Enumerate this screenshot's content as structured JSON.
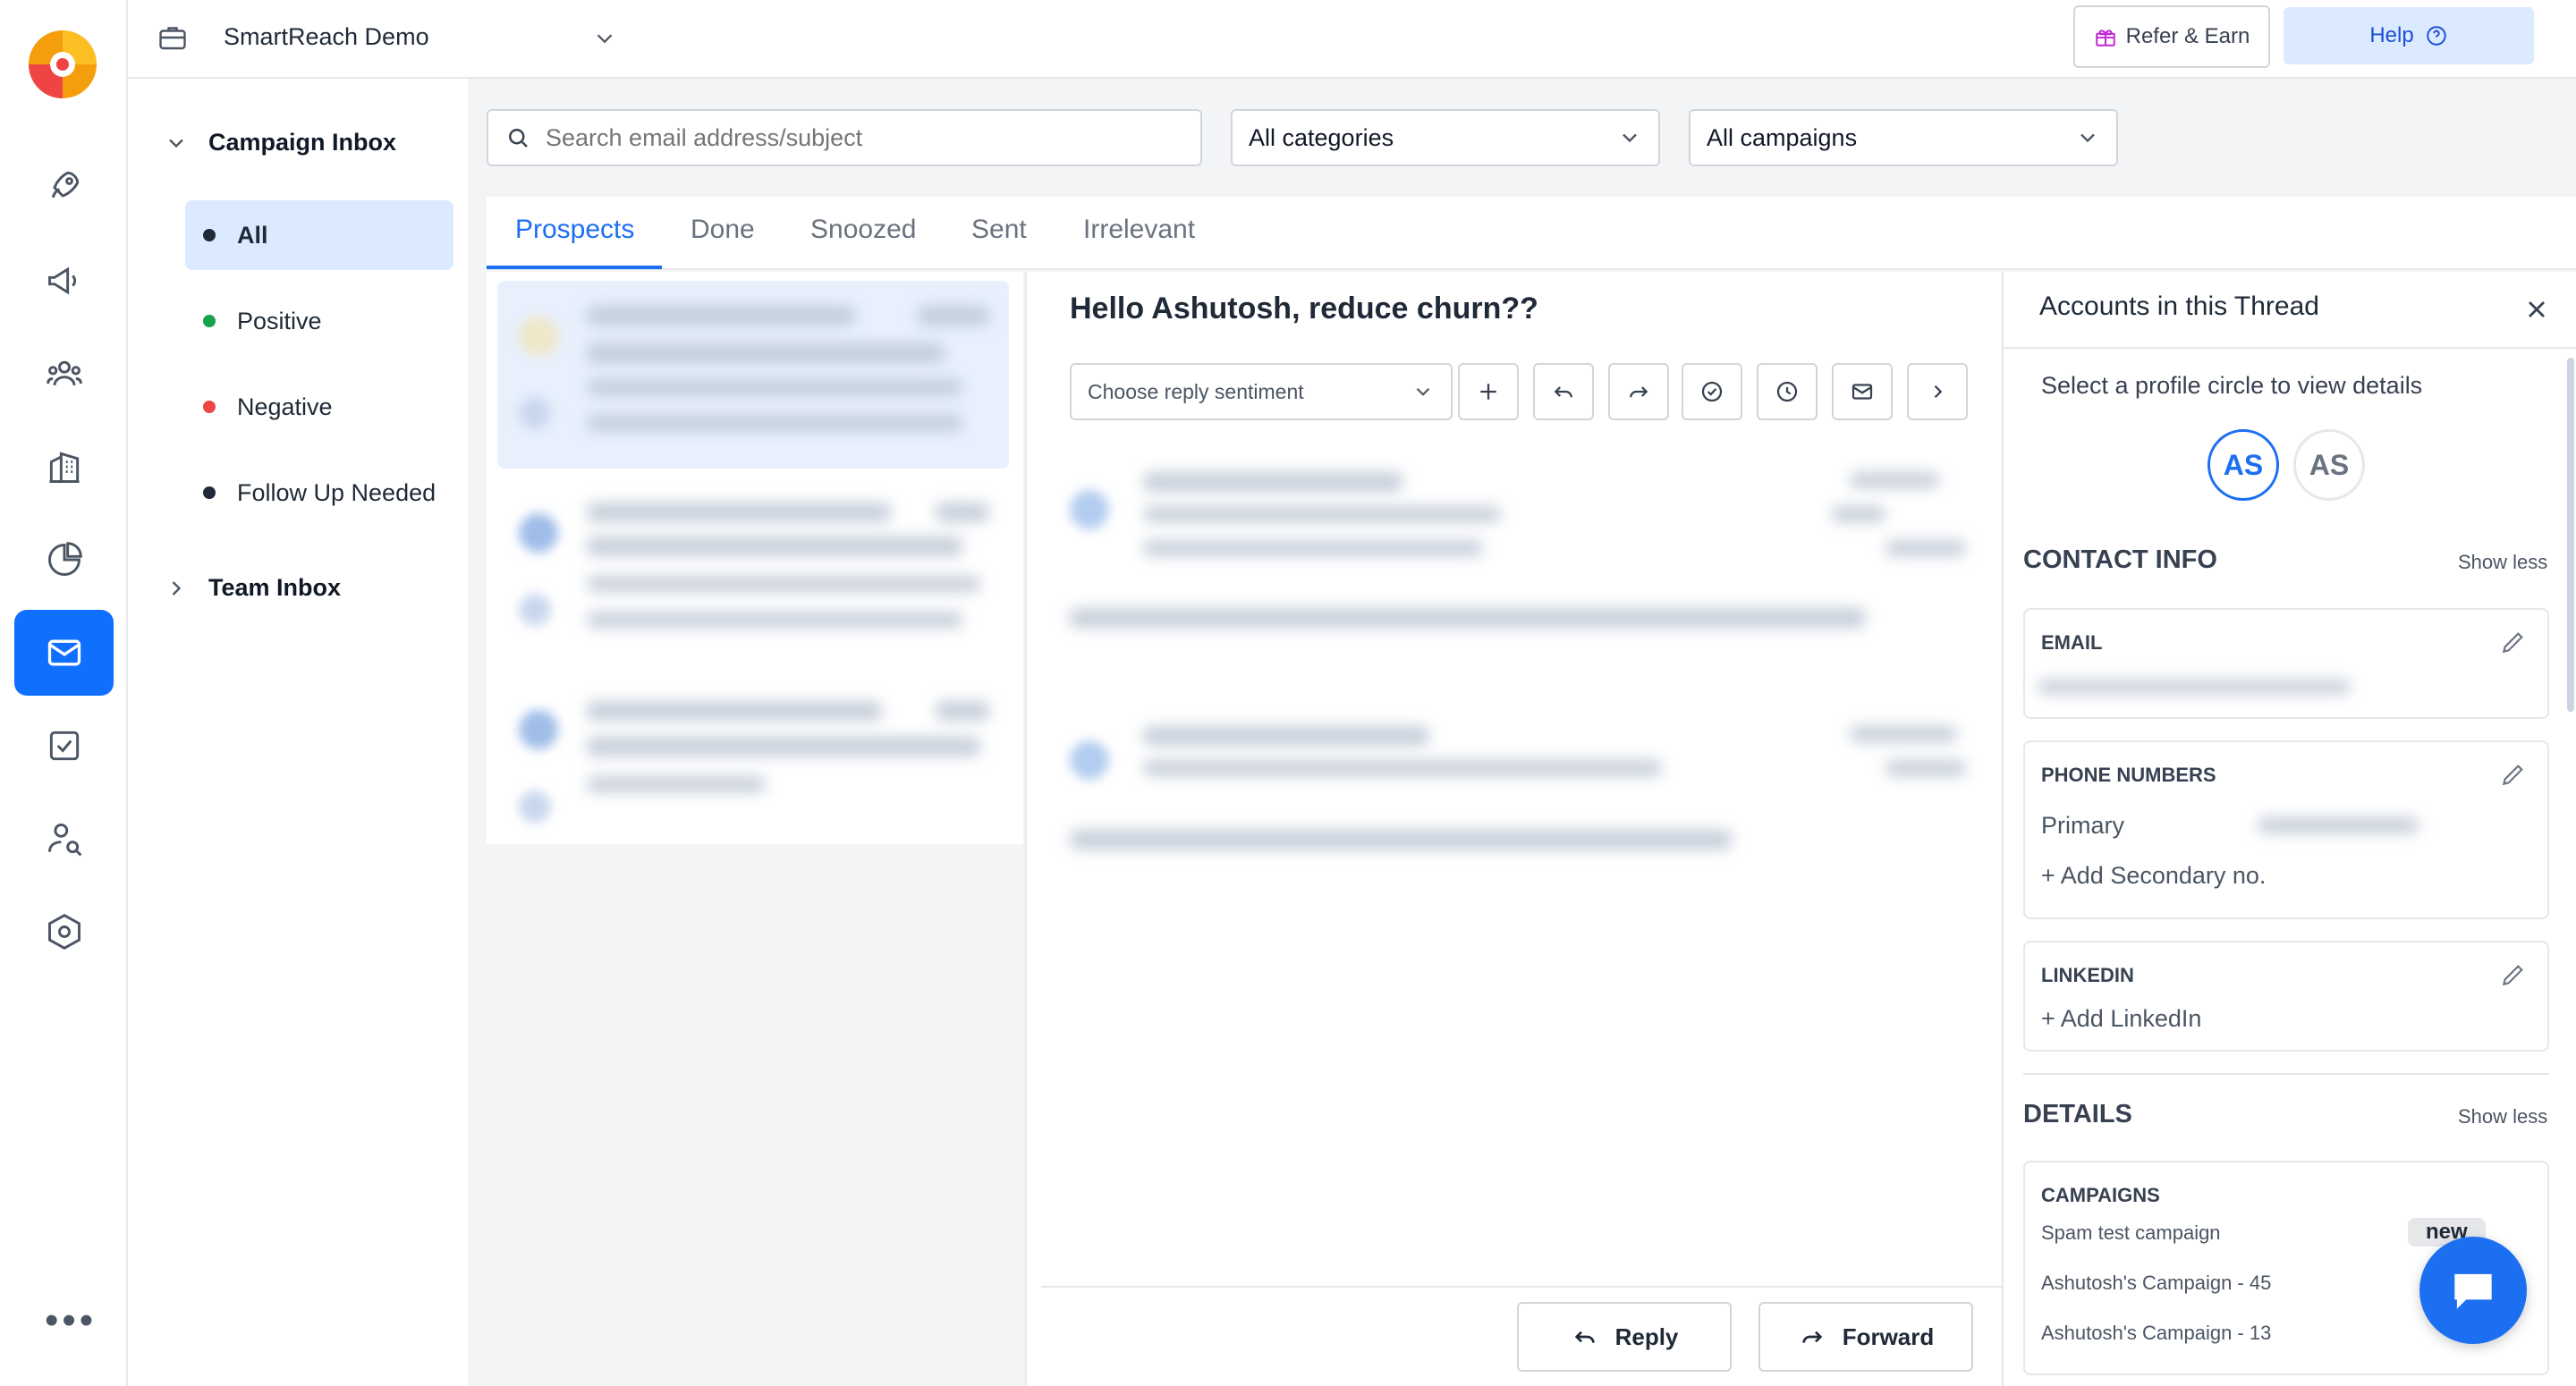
{
  "workspace": {
    "name": "SmartReach Demo"
  },
  "header": {
    "refer_label": "Refer & Earn",
    "help_label": "Help"
  },
  "inbox": {
    "campaign_inbox_label": "Campaign Inbox",
    "team_inbox_label": "Team Inbox",
    "categories": [
      {
        "label": "All",
        "dot_color": "#1f2937"
      },
      {
        "label": "Positive",
        "dot_color": "#16a34a"
      },
      {
        "label": "Negative",
        "dot_color": "#ef4444"
      },
      {
        "label": "Follow Up Needed",
        "dot_color": "#1f2937"
      }
    ]
  },
  "filters": {
    "search_placeholder": "Search email address/subject",
    "category_value": "All categories",
    "campaign_value": "All campaigns"
  },
  "tabs": [
    "Prospects",
    "Done",
    "Snoozed",
    "Sent",
    "Irrelevant"
  ],
  "thread": {
    "subject": "Hello Ashutosh, reduce churn??",
    "sentiment_placeholder": "Choose reply sentiment",
    "reply_label": "Reply",
    "forward_label": "Forward"
  },
  "accounts": {
    "title": "Accounts in this Thread",
    "hint": "Select a profile circle to view details",
    "avatars": [
      "AS",
      "AS"
    ]
  },
  "contact_info": {
    "title": "CONTACT INFO",
    "toggle_label": "Show less",
    "email_label": "EMAIL",
    "phone_label": "PHONE NUMBERS",
    "primary_label": "Primary",
    "add_secondary": "+ Add Secondary no.",
    "linkedin_label": "LINKEDIN",
    "add_linkedin": "+ Add LinkedIn"
  },
  "details": {
    "title": "DETAILS",
    "toggle_label": "Show less",
    "campaigns_label": "CAMPAIGNS",
    "campaigns": [
      "Spam test campaign",
      "Ashutosh's Campaign - 45",
      "Ashutosh's Campaign - 13"
    ],
    "new_badge": "new"
  },
  "colors": {
    "accent": "#1d6ff2",
    "rail_active": "#0f6fff",
    "active_bg": "#dbeafe"
  }
}
